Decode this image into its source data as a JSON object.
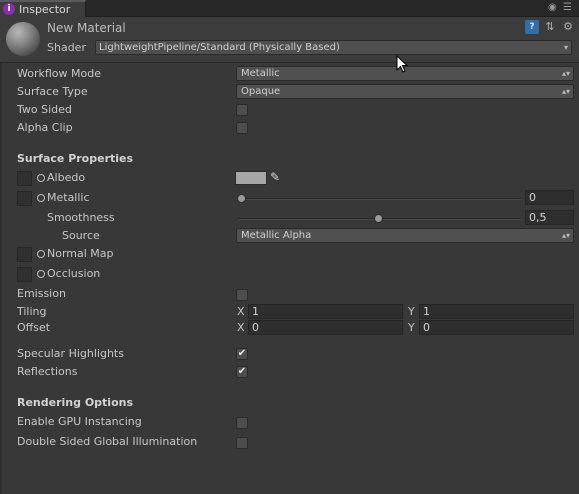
{
  "tab": {
    "label": "Inspector",
    "icon": "info-icon",
    "icon_glyph": "i"
  },
  "header": {
    "material_name": "New Material",
    "shader_label": "Shader",
    "shader_value": "LightweightPipeline/Standard (Physically Based)"
  },
  "workflow": {
    "workflow_mode_label": "Workflow Mode",
    "workflow_mode_value": "Metallic",
    "surface_type_label": "Surface Type",
    "surface_type_value": "Opaque",
    "two_sided_label": "Two Sided",
    "two_sided_checked": false,
    "alpha_clip_label": "Alpha Clip",
    "alpha_clip_checked": false
  },
  "surface": {
    "title": "Surface Properties",
    "albedo_label": "Albedo",
    "albedo_color": "#a6a6a6",
    "metallic_label": "Metallic",
    "metallic_value": "0",
    "metallic_slider": 0.0,
    "smoothness_label": "Smoothness",
    "smoothness_value": "0,5",
    "smoothness_slider": 0.5,
    "source_label": "Source",
    "source_value": "Metallic Alpha",
    "normal_map_label": "Normal Map",
    "occlusion_label": "Occlusion",
    "emission_label": "Emission",
    "emission_checked": false,
    "tiling_label": "Tiling",
    "tiling_x": "1",
    "tiling_y": "1",
    "offset_label": "Offset",
    "offset_x": "0",
    "offset_y": "0",
    "x_axis": "X",
    "y_axis": "Y",
    "specular_label": "Specular Highlights",
    "specular_checked": true,
    "reflections_label": "Reflections",
    "reflections_checked": true
  },
  "rendering": {
    "title": "Rendering Options",
    "gpu_instancing_label": "Enable GPU Instancing",
    "gpu_instancing_checked": false,
    "double_sided_gi_label": "Double Sided Global Illumination",
    "double_sided_gi_checked": false
  },
  "glyphs": {
    "dropdown_arrow": "▴▾",
    "check": "✔"
  }
}
